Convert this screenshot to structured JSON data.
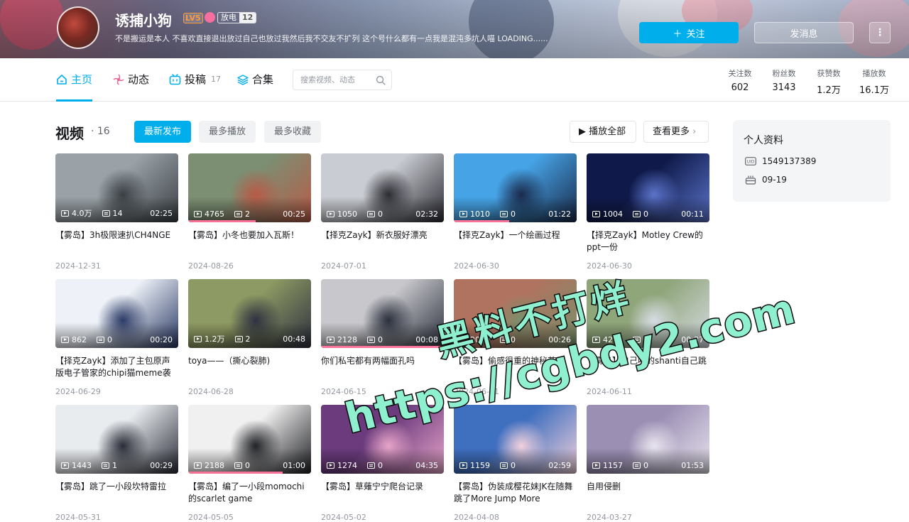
{
  "banner": {
    "username": "诱捕小狗",
    "level": "LV5",
    "medal_name": "放电",
    "medal_level": "12",
    "sign": "不是搬运是本人 不喜欢直接退出放过自己也放过我然后我不交友不扩列 这个号什么都有一点我是混沌多坑人喵 LOADING......",
    "follow_label": "关注",
    "message_label": "发消息",
    "more_label": "⋮"
  },
  "nav": {
    "tabs": [
      {
        "label": "主页",
        "count": ""
      },
      {
        "label": "动态",
        "count": ""
      },
      {
        "label": "投稿",
        "count": "17"
      },
      {
        "label": "合集",
        "count": ""
      }
    ],
    "search_placeholder": "搜索视频、动态",
    "stats": [
      {
        "label": "关注数",
        "value": "602"
      },
      {
        "label": "粉丝数",
        "value": "3143"
      },
      {
        "label": "获赞数",
        "value": "1.2万"
      },
      {
        "label": "播放数",
        "value": "16.1万"
      }
    ]
  },
  "videos_section": {
    "title": "视频",
    "count": "· 16",
    "filters": [
      "最新发布",
      "最多播放",
      "最多收藏"
    ],
    "play_all": "播放全部",
    "see_more": "查看更多"
  },
  "videos": [
    {
      "title": "【雾岛】3h极限速扒CH4NGE",
      "plays": "4.0万",
      "danmaku": "14",
      "duration": "02:25",
      "date": "2024-12-31",
      "progress": 0,
      "bg": "#9aa2a7",
      "bg2": "#3a3f44"
    },
    {
      "title": "【雾岛】小冬也要加入瓦斯！",
      "plays": "4765",
      "danmaku": "2",
      "duration": "00:25",
      "date": "2024-08-26",
      "progress": 0.55,
      "bg": "#7c8f73",
      "bg2": "#b85a47"
    },
    {
      "title": "【择克Zayk】新衣服好漂亮",
      "plays": "1050",
      "danmaku": "0",
      "duration": "02:32",
      "date": "2024-07-01",
      "progress": 0,
      "bg": "#c9ccd2",
      "bg2": "#2c2c33"
    },
    {
      "title": "【择克Zayk】一个绘画过程",
      "plays": "1010",
      "danmaku": "0",
      "duration": "01:22",
      "date": "2024-06-30",
      "progress": 0.45,
      "bg": "#46a3e6",
      "bg2": "#1a2a4a"
    },
    {
      "title": "【择克Zayk】Motley Crew的ppt一份",
      "plays": "1004",
      "danmaku": "0",
      "duration": "00:11",
      "date": "2024-06-30",
      "progress": 0,
      "bg": "#0f1a4a",
      "bg2": "#5b73c9"
    },
    {
      "title": "【择克Zayk】添加了主包原声版电子管家的chipi猫meme袭来",
      "plays": "862",
      "danmaku": "0",
      "duration": "00:20",
      "date": "2024-06-29",
      "progress": 0,
      "bg": "#eef2f8",
      "bg2": "#2b3a66"
    },
    {
      "title": "toya——（撕心裂肺)",
      "plays": "1.2万",
      "danmaku": "2",
      "duration": "00:48",
      "date": "2024-06-28",
      "progress": 0,
      "bg": "#8e9a63",
      "bg2": "#2f3140"
    },
    {
      "title": "你们私宅都有两幅面孔吗",
      "plays": "2128",
      "danmaku": "0",
      "duration": "00:08",
      "date": "2024-06-15",
      "progress": 1,
      "bg": "#c8c8cc",
      "bg2": "#2a2f3c"
    },
    {
      "title": "【雾岛】偷感很重的神秘节目",
      "plays": "2019",
      "danmaku": "0",
      "duration": "00:26",
      "date": "2024-06-11",
      "progress": 0,
      "bg": "#b0735f",
      "bg2": "#78906c"
    },
    {
      "title": "【雾岛】自己唱的shanti自己跳",
      "plays": "4241",
      "danmaku": "0",
      "duration": "00:37",
      "date": "2024-06-11",
      "progress": 0,
      "bg": "#8fa57a",
      "bg2": "#d7dce3"
    },
    {
      "title": "【雾岛】跳了一小段坎特雷拉",
      "plays": "1443",
      "danmaku": "1",
      "duration": "00:29",
      "date": "2024-05-31",
      "progress": 0,
      "bg": "#e9ecef",
      "bg2": "#2a2d38"
    },
    {
      "title": "【雾岛】编了一小段momochi的scarlet game",
      "plays": "2188",
      "danmaku": "0",
      "duration": "01:00",
      "date": "2024-05-05",
      "progress": 0.77,
      "bg": "#f0f0f0",
      "bg2": "#202125"
    },
    {
      "title": "【雾岛】草薙宁宁爬台记录",
      "plays": "1274",
      "danmaku": "0",
      "duration": "04:35",
      "date": "2024-05-02",
      "progress": 0,
      "bg": "#6b3b7d",
      "bg2": "#e7a4c8"
    },
    {
      "title": "【雾岛】伪装成樱花妹JK在随舞跳了More Jump More",
      "plays": "1159",
      "danmaku": "0",
      "duration": "02:59",
      "date": "2024-04-08",
      "progress": 0,
      "bg": "#3f6fbf",
      "bg2": "#f0d0dc"
    },
    {
      "title": "自用侵删",
      "plays": "1157",
      "danmaku": "0",
      "duration": "01:53",
      "date": "2024-03-27",
      "progress": 0,
      "bg": "#9b8fb4",
      "bg2": "#e8e4ee"
    }
  ],
  "profile": {
    "title": "个人资料",
    "uid": "1549137389",
    "birthday": "09-19"
  },
  "watermark": {
    "line1": "黑料不打烊",
    "line2": "https://cgbdy2.com"
  },
  "colors": {
    "accent": "#00aeec",
    "progress": "#fb7299",
    "watermark": "#8ff0cf"
  }
}
